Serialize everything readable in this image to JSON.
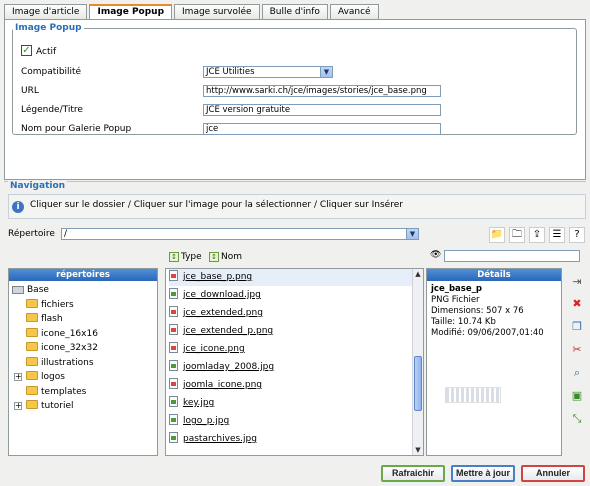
{
  "tabs": [
    "Image d'article",
    "Image Popup",
    "Image survolée",
    "Bulle d'info",
    "Avancé"
  ],
  "active_tab": 1,
  "popup": {
    "legend": "Image Popup",
    "actif_label": "Actif",
    "actif_checked": true,
    "compat_label": "Compatibilité",
    "compat_value": "JCE Utilities",
    "url_label": "URL",
    "url_value": "http://www.sarki.ch/jce/images/stories/jce_base.png",
    "legende_label": "Légende/Titre",
    "legende_value": "JCE version gratuite",
    "galerie_label": "Nom pour Galerie Popup",
    "galerie_value": "jce"
  },
  "navigation": {
    "legend": "Navigation",
    "info": "Cliquer sur le dossier / Cliquer sur l'image pour la sélectionner / Cliquer sur Insérer",
    "dir_label": "Répertoire",
    "dir_value": "/",
    "sort_type": "Type",
    "sort_name": "Nom",
    "dirs_header": "répertoires",
    "details_header": "Détails"
  },
  "tree": [
    {
      "label": "Base"
    },
    {
      "label": "fichiers"
    },
    {
      "label": "flash"
    },
    {
      "label": "icone_16x16"
    },
    {
      "label": "icone_32x32"
    },
    {
      "label": "illustrations"
    },
    {
      "label": "logos"
    },
    {
      "label": "templates"
    },
    {
      "label": "tutoriel"
    }
  ],
  "files": [
    {
      "name": "jce_base_p.png",
      "type": "png"
    },
    {
      "name": "jce_download.jpg",
      "type": "jpg"
    },
    {
      "name": "jce_extended.png",
      "type": "png"
    },
    {
      "name": "jce_extended_p.png",
      "type": "png"
    },
    {
      "name": "jce_icone.png",
      "type": "png"
    },
    {
      "name": "joomladay_2008.jpg",
      "type": "jpg"
    },
    {
      "name": "joomla_icone.png",
      "type": "png"
    },
    {
      "name": "key.jpg",
      "type": "jpg"
    },
    {
      "name": "logo_p.jpg",
      "type": "jpg"
    },
    {
      "name": "pastarchives.jpg",
      "type": "jpg"
    }
  ],
  "details": {
    "name": "jce_base_p",
    "type": "PNG Fichier",
    "dims": "Dimensions: 507 x 76",
    "size": "Taille: 10.74 Kb",
    "modified": "Modifié: 09/06/2007,01:40"
  },
  "buttons": {
    "refresh": "Rafraichir",
    "update": "Mettre à jour",
    "cancel": "Annuler"
  },
  "icons": {
    "info": "info-icon",
    "bin": "binoculars-icon"
  },
  "colors": {
    "accent": "#2b6fb6",
    "header_blue": "#2c67b8",
    "refresh_border": "#6aa84a",
    "update_border": "#4a7fc7",
    "cancel_border": "#d04444"
  }
}
